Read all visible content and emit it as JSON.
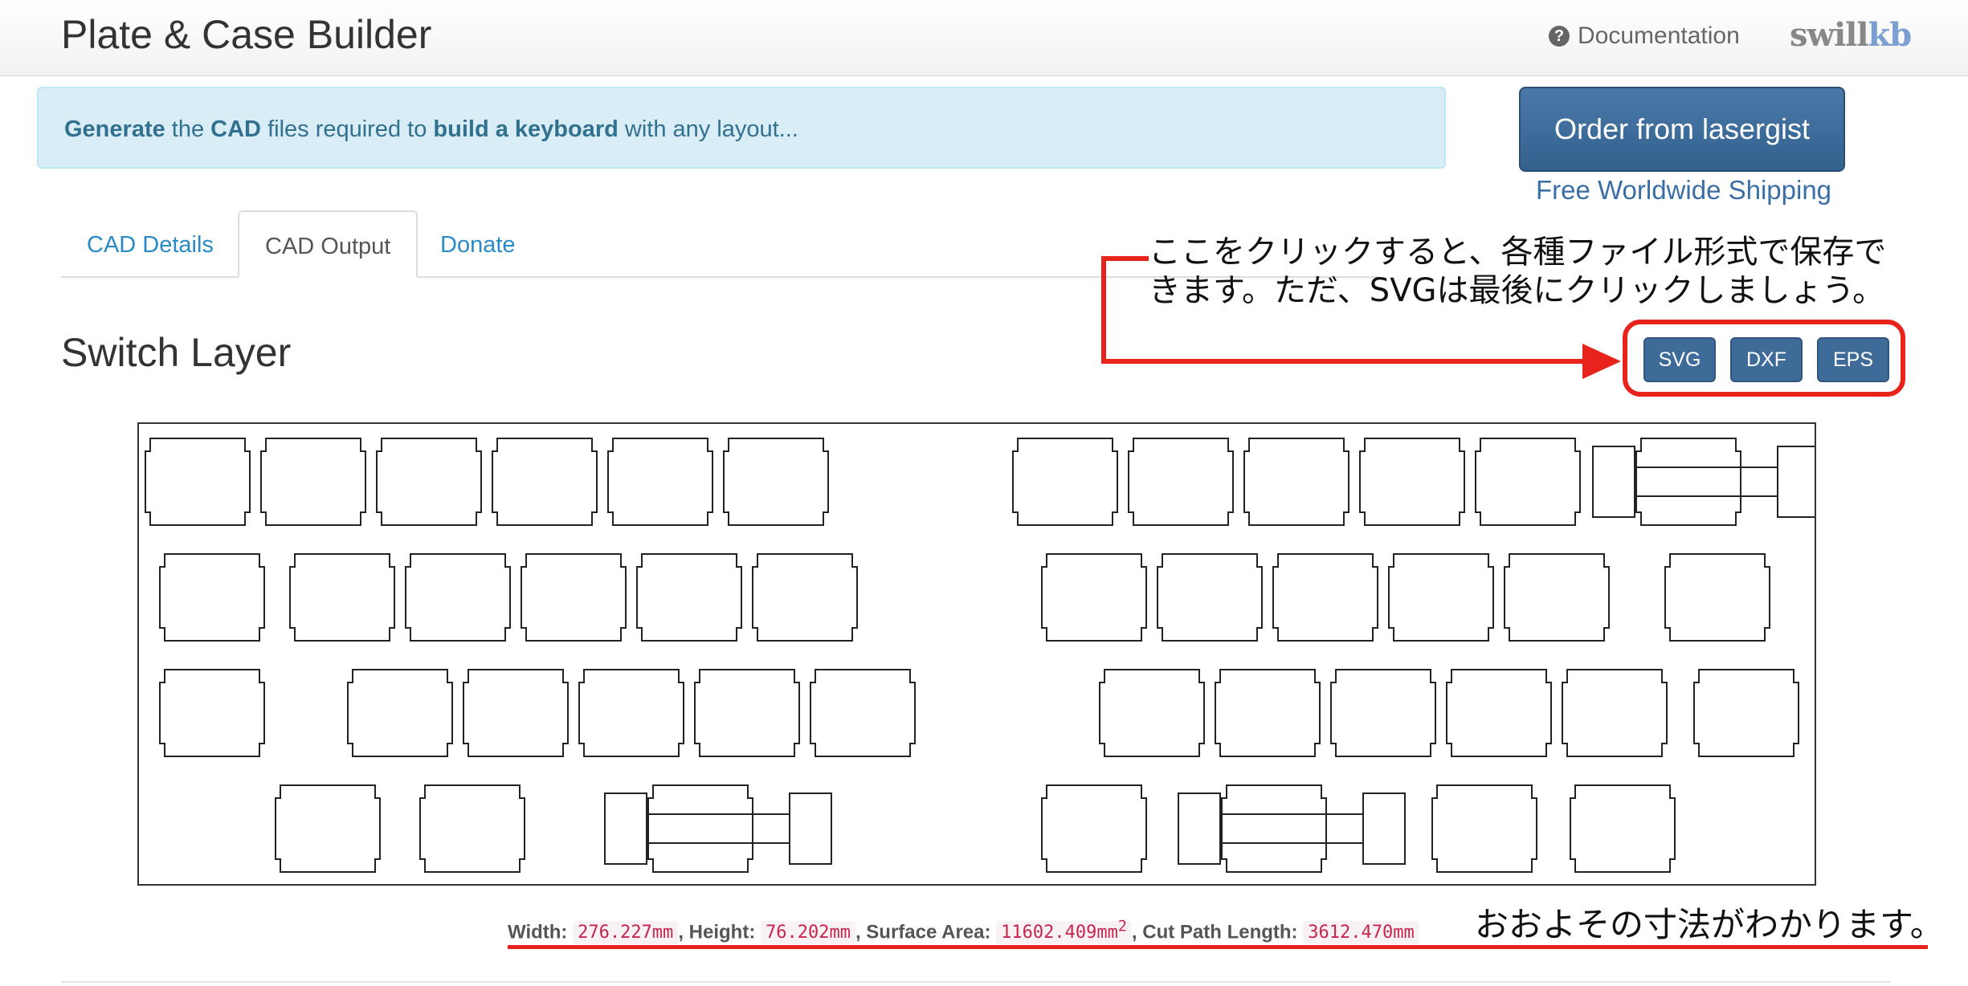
{
  "navbar": {
    "title": "Plate & Case Builder",
    "docs_label": "Documentation",
    "logo_part1": "swill",
    "logo_part2": "kb"
  },
  "alert": {
    "w1": "Generate",
    "t1": " the ",
    "w2": "CAD",
    "t2": " files required to ",
    "w3": "build a keyboard",
    "t3": " with any layout..."
  },
  "order": {
    "button_label": "Order from lasergist",
    "shipping": "Free Worldwide Shipping"
  },
  "tabs": [
    {
      "label": "CAD Details"
    },
    {
      "label": "CAD Output"
    },
    {
      "label": "Donate"
    }
  ],
  "section": {
    "title": "Switch Layer"
  },
  "download": {
    "svg": "SVG",
    "dxf": "DXF",
    "eps": "EPS"
  },
  "annotations": {
    "buttons_note_line1": "ここをクリックすると、各種ファイル形式で保存で",
    "buttons_note_line2": "きます。ただ、SVGは最後にクリックしましょう。",
    "dims_note": "おおよその寸法がわかります。"
  },
  "dimensions": {
    "width_label": "Width:",
    "width_value": "276.227mm",
    "height_label": "Height:",
    "height_value": "76.202mm",
    "area_label": "Surface Area:",
    "area_value": "11602.409mm",
    "area_sup": "2",
    "cut_label": "Cut Path Length:",
    "cut_value": "3612.470mm"
  },
  "colors": {
    "annotation_red": "#e8231b",
    "button_blue": "#3f6b99",
    "link_blue": "#2a8ac8"
  }
}
